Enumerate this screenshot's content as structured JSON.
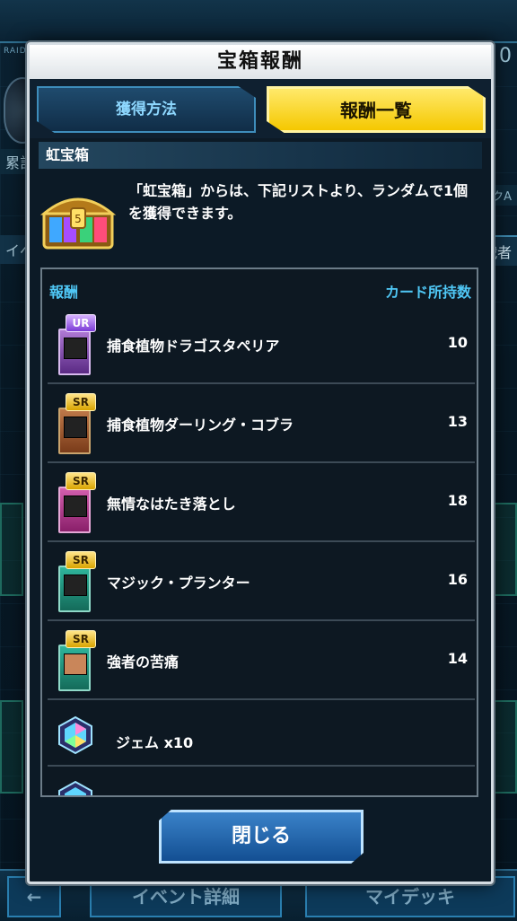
{
  "background": {
    "raid_label": "RAID DUEL",
    "top_right_number": "0",
    "left_tab_a": "累計",
    "left_tab_b": "イベ",
    "right_tab_a": "クA",
    "right_tab_b": "戦者",
    "bottom_left_label": "イベント詳細",
    "bottom_right_label": "マイデッキ"
  },
  "modal": {
    "title": "宝箱報酬",
    "tabs": [
      {
        "label": "獲得方法",
        "active": false
      },
      {
        "label": "報酬一覧",
        "active": true
      }
    ],
    "section_title": "虹宝箱",
    "chest_icon": "rainbow-treasure-chest-icon",
    "description": "「虹宝箱」からは、下記リストより、ランダムで1個を獲得できます。",
    "list": {
      "header_left": "報酬",
      "header_right": "カード所持数",
      "items": [
        {
          "rarity": "UR",
          "name": "捕食植物ドラゴスタペリア",
          "count": "10",
          "card_type": "fusion"
        },
        {
          "rarity": "SR",
          "name": "捕食植物ダーリング・コブラ",
          "count": "13",
          "card_type": "effect"
        },
        {
          "rarity": "SR",
          "name": "無情なはたき落とし",
          "count": "18",
          "card_type": "trap"
        },
        {
          "rarity": "SR",
          "name": "マジック・プランター",
          "count": "16",
          "card_type": "spell"
        },
        {
          "rarity": "SR",
          "name": "強者の苦痛",
          "count": "14",
          "card_type": "spell"
        },
        {
          "rarity": "",
          "name": "ジェム x10",
          "count": "",
          "card_type": "gem"
        }
      ]
    },
    "close_label": "閉じる"
  },
  "colors": {
    "accent_blue": "#4fc7f5",
    "active_tab_yellow": "#f5c800",
    "panel_bg": "#0c1a26"
  }
}
